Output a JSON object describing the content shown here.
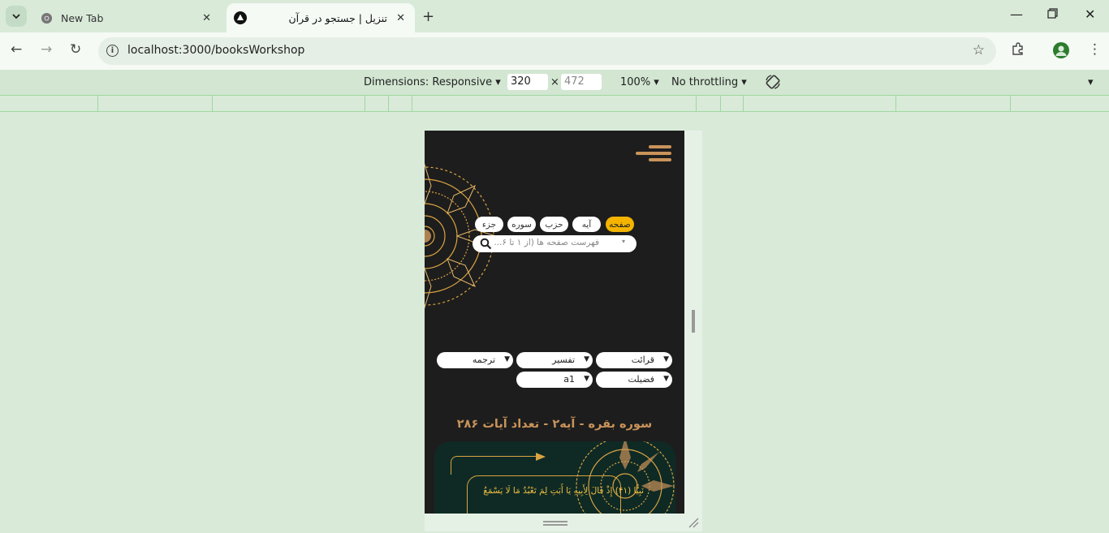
{
  "browser": {
    "tabs": [
      {
        "label": "New Tab",
        "icon": "chrome-icon"
      },
      {
        "label": "تنزیل | جستجو در قرآن",
        "icon": "app-logo-icon"
      }
    ],
    "url": "localhost:3000/booksWorkshop"
  },
  "devtools": {
    "dimensions_label": "Dimensions: Responsive",
    "width": "320",
    "height": "472",
    "times": "×",
    "zoom": "100%",
    "throttling": "No throttling"
  },
  "app": {
    "search_tabs": [
      {
        "label": "صفحه",
        "active": true
      },
      {
        "label": "آیه",
        "active": false
      },
      {
        "label": "حزب",
        "active": false
      },
      {
        "label": "سوره",
        "active": false
      },
      {
        "label": "جزء",
        "active": false
      }
    ],
    "search_placeholder": "فهرست صفحه ها (از ۱ تا ۶...",
    "dropdowns": {
      "qiraat": "قرائت",
      "tafsir": "تفسیر",
      "tarjome": "ترجمه",
      "fazilat": "فضیلت",
      "a1": "a1"
    },
    "surah_title": "سوره بقره - آیه۲ - تعداد آیات ۲۸۶",
    "verse_text": "نَبِيًّا (۴۱) إِذْ قَالَ لِأَبِيهِ يَا أَبَتِ لِمَ تَعْبُدُ مَا لَا يَسْمَعُ"
  },
  "colors": {
    "accent": "#f4b400",
    "gold": "#c9935a",
    "app_bg": "#1d1d1d"
  }
}
